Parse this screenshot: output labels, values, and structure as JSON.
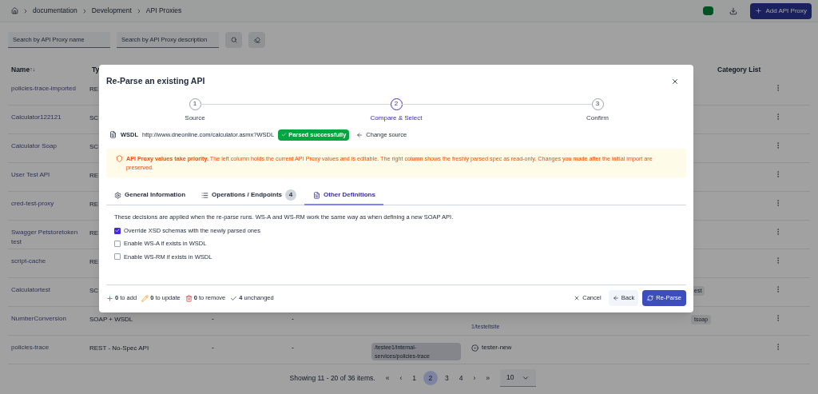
{
  "breadcrumb": [
    "documentation",
    "Development",
    "API Proxies"
  ],
  "toolbar": {
    "add_button": "Add API Proxy"
  },
  "filters": [
    {
      "placeholder": "Search by API Proxy name"
    },
    {
      "placeholder": "Search by API Proxy description"
    }
  ],
  "table": {
    "columns": [
      "Name",
      "Ty",
      "Category List"
    ],
    "sort_indicator": "↑↓",
    "rows": [
      {
        "name": "policies-trace-imported",
        "type": "RE"
      },
      {
        "name": "Calculator122121",
        "type": "SC"
      },
      {
        "name": "Calculator Soap",
        "type": "SC"
      },
      {
        "name": "User Test API",
        "type": "RE"
      },
      {
        "name": "cred-test-proxy",
        "type": "RE"
      },
      {
        "name": "Swagger Petstoretoken test",
        "type": "RE"
      },
      {
        "name": "script-cache",
        "type": "RE"
      },
      {
        "name": "Calculatortest",
        "type": "SC",
        "category": "est"
      },
      {
        "name": "NumberConversion",
        "type": "SOAP + WSDL",
        "column_3": "-",
        "column_4": "-",
        "link": "1/testeltsite",
        "category": "tsoap"
      },
      {
        "name": "policies-trace",
        "type": "REST - No-Spec API",
        "column_3": "-",
        "column_4": "-",
        "path": "/testee1/internal-services/policies-trace",
        "environment": "tester-new"
      }
    ]
  },
  "pagination": {
    "summary": "Showing 11 - 20 of 36 items.",
    "first": "«",
    "prev": "‹",
    "next": "›",
    "last": "»",
    "pages": [
      {
        "label": "1",
        "selected": false
      },
      {
        "label": "2",
        "selected": true
      },
      {
        "label": "3",
        "selected": false
      },
      {
        "label": "4",
        "selected": false
      }
    ],
    "page_size": "10"
  },
  "modal": {
    "title": "Re-Parse an existing API",
    "steps": [
      {
        "number": "1",
        "label": "Source",
        "selected": false
      },
      {
        "number": "2",
        "label": "Compare & Select",
        "selected": true
      },
      {
        "number": "3",
        "label": "Confirm",
        "selected": false
      }
    ],
    "source": {
      "type": "WSDL",
      "url": "http://www.dneonline.com/calculator.asmx?WSDL",
      "status": "Parsed successfully",
      "change_link": "Change source"
    },
    "alert": "**API Proxy values take priority.** The left column holds the current API Proxy values and is editable. The right column shows the freshly parsed spec as read-only. Changes you made after the initial import are preserved.",
    "tabs": [
      {
        "kind": "gear",
        "label": "General Information",
        "selected": false
      },
      {
        "kind": "list",
        "label": "Operations / Endpoints",
        "badge": "4",
        "selected": false
      },
      {
        "kind": "file",
        "label": "Other Definitions",
        "selected": true
      }
    ],
    "description": "These decisions are applied when the re-parse runs. WS-A and WS-RM work the same way as when defining a new SOAP API.",
    "options": [
      {
        "label": "Override XSD schemas with the newly parsed ones",
        "checked": true
      },
      {
        "label": "Enable WS-A if exists in WSDL",
        "checked": false
      },
      {
        "label": "Enable WS-RM if exists in WSDL",
        "checked": false
      }
    ],
    "summary": [
      {
        "kind": "add",
        "count": "0",
        "text": "to add"
      },
      {
        "kind": "update",
        "count": "0",
        "text": "to update"
      },
      {
        "kind": "remove",
        "count": "0",
        "text": "to remove"
      },
      {
        "kind": "unchanged",
        "count": "4",
        "text": "unchanged"
      }
    ],
    "buttons": {
      "cancel": "Cancel",
      "back": "Back",
      "submit": "Re-Parse"
    }
  }
}
